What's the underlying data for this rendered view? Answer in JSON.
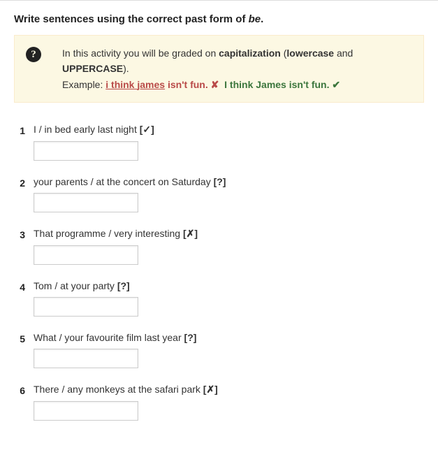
{
  "title_prefix": "Write sentences using the correct past form of ",
  "title_em": "be",
  "title_suffix": ".",
  "hint": {
    "icon": "?",
    "line1_a": "In this activity you will be graded on ",
    "line1_b": "capitalization",
    "line1_c": " (",
    "line1_d": "lowercase",
    "line1_e": " and ",
    "line1_f": "UPPERCASE",
    "line1_g": ").",
    "example_label": "Example: ",
    "wrong_part1": "i think ",
    "wrong_part2": "james",
    "wrong_part3": " isn't fun.",
    "wrong_mark": "✘",
    "right_text": "I think James isn't fun.",
    "right_mark": "✔"
  },
  "questions": [
    {
      "num": "1",
      "prompt": "I / in bed early last night ",
      "tag": "[✓]",
      "value": ""
    },
    {
      "num": "2",
      "prompt": "your parents / at the concert on Saturday ",
      "tag": "[?]",
      "value": ""
    },
    {
      "num": "3",
      "prompt": "That programme / very interesting ",
      "tag": "[✗]",
      "value": ""
    },
    {
      "num": "4",
      "prompt": "Tom / at your party ",
      "tag": "[?]",
      "value": ""
    },
    {
      "num": "5",
      "prompt": "What / your favourite film last year ",
      "tag": "[?]",
      "value": ""
    },
    {
      "num": "6",
      "prompt": "There / any monkeys at the safari park ",
      "tag": "[✗]",
      "value": ""
    }
  ]
}
